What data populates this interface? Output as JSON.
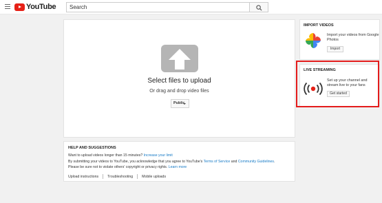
{
  "header": {
    "logo_text": "YouTube",
    "search_placeholder": "Search"
  },
  "upload": {
    "title": "Select files to upload",
    "subtitle": "Or drag and drop video files",
    "privacy_value": "Public"
  },
  "help": {
    "title": "HELP AND SUGGESTIONS",
    "line1_text": "Want to upload videos longer than 15 minutes? ",
    "line1_link": "Increase your limit",
    "line2_text": "By submitting your videos to YouTube, you acknowledge that you agree to YouTube's ",
    "line2_link1": "Terms of Service",
    "line2_and": " and ",
    "line2_link2": "Community Guidelines",
    "line2_end": ".",
    "line3_text": "Please be sure not to violate others' copyright or privacy rights. ",
    "line3_link": "Learn more",
    "footer_links": [
      "Upload instructions",
      "Troubleshooting",
      "Mobile uploads"
    ]
  },
  "import": {
    "title": "IMPORT VIDEOS",
    "description": "Import your videos from Google Photos",
    "button": "Import",
    "icon": "google-photos-icon"
  },
  "live": {
    "title": "LIVE STREAMING",
    "description": "Set up your channel and stream live to your fans",
    "button": "Get started",
    "icon": "live-broadcast-icon"
  },
  "colors": {
    "brand_red": "#e62117",
    "link_blue": "#167ac6",
    "highlight_red": "#e41b1b",
    "background": "#f1f1f1"
  }
}
